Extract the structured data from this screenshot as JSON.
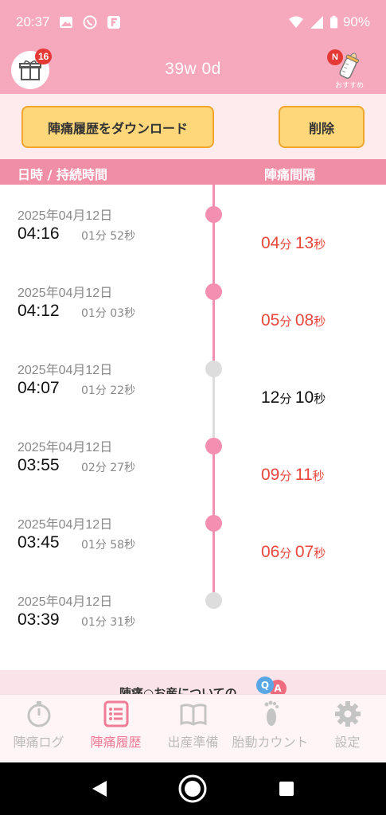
{
  "status_bar": {
    "time": "20:37",
    "battery": "90%"
  },
  "header": {
    "title": "39w 0d",
    "gift_badge": "16",
    "new_badge": "N",
    "recommend_label": "おすすめ"
  },
  "actions": {
    "download_label": "陣痛履歴をダウンロード",
    "delete_label": "削除"
  },
  "columns": {
    "left": "日時 / 持続時間",
    "right": "陣痛間隔"
  },
  "colors": {
    "pink": "#f6a9bc",
    "accent_red": "#e8473c",
    "dot_pink": "#f48fb1",
    "dot_gray": "#dddddd"
  },
  "entries": [
    {
      "date": "2025年04月12日",
      "time": "04:16",
      "duration": "01分 52秒",
      "dot": "pink"
    },
    {
      "date": "2025年04月12日",
      "time": "04:12",
      "duration": "01分 03秒",
      "dot": "pink"
    },
    {
      "date": "2025年04月12日",
      "time": "04:07",
      "duration": "01分 22秒",
      "dot": "gray"
    },
    {
      "date": "2025年04月12日",
      "time": "03:55",
      "duration": "02分 27秒",
      "dot": "pink"
    },
    {
      "date": "2025年04月12日",
      "time": "03:45",
      "duration": "01分 58秒",
      "dot": "pink"
    },
    {
      "date": "2025年04月12日",
      "time": "03:39",
      "duration": "01分 31秒",
      "dot": "gray"
    }
  ],
  "intervals": [
    {
      "min": "04",
      "min_unit": "分",
      "sec": "13",
      "sec_unit": "秒",
      "color": "red"
    },
    {
      "min": "05",
      "min_unit": "分",
      "sec": "08",
      "sec_unit": "秒",
      "color": "red"
    },
    {
      "min": "12",
      "min_unit": "分",
      "sec": "10",
      "sec_unit": "秒",
      "color": "black"
    },
    {
      "min": "09",
      "min_unit": "分",
      "sec": "11",
      "sec_unit": "秒",
      "color": "red"
    },
    {
      "min": "06",
      "min_unit": "分",
      "sec": "07",
      "sec_unit": "秒",
      "color": "red"
    }
  ],
  "banner": {
    "text": "陣痛○お産についての"
  },
  "nav": [
    {
      "label": "陣痛ログ",
      "icon": "stopwatch-icon",
      "active": false
    },
    {
      "label": "陣痛履歴",
      "icon": "list-icon",
      "active": true
    },
    {
      "label": "出産準備",
      "icon": "book-icon",
      "active": false
    },
    {
      "label": "胎動カウント",
      "icon": "footprint-icon",
      "active": false
    },
    {
      "label": "設定",
      "icon": "gear-icon",
      "active": false
    }
  ]
}
